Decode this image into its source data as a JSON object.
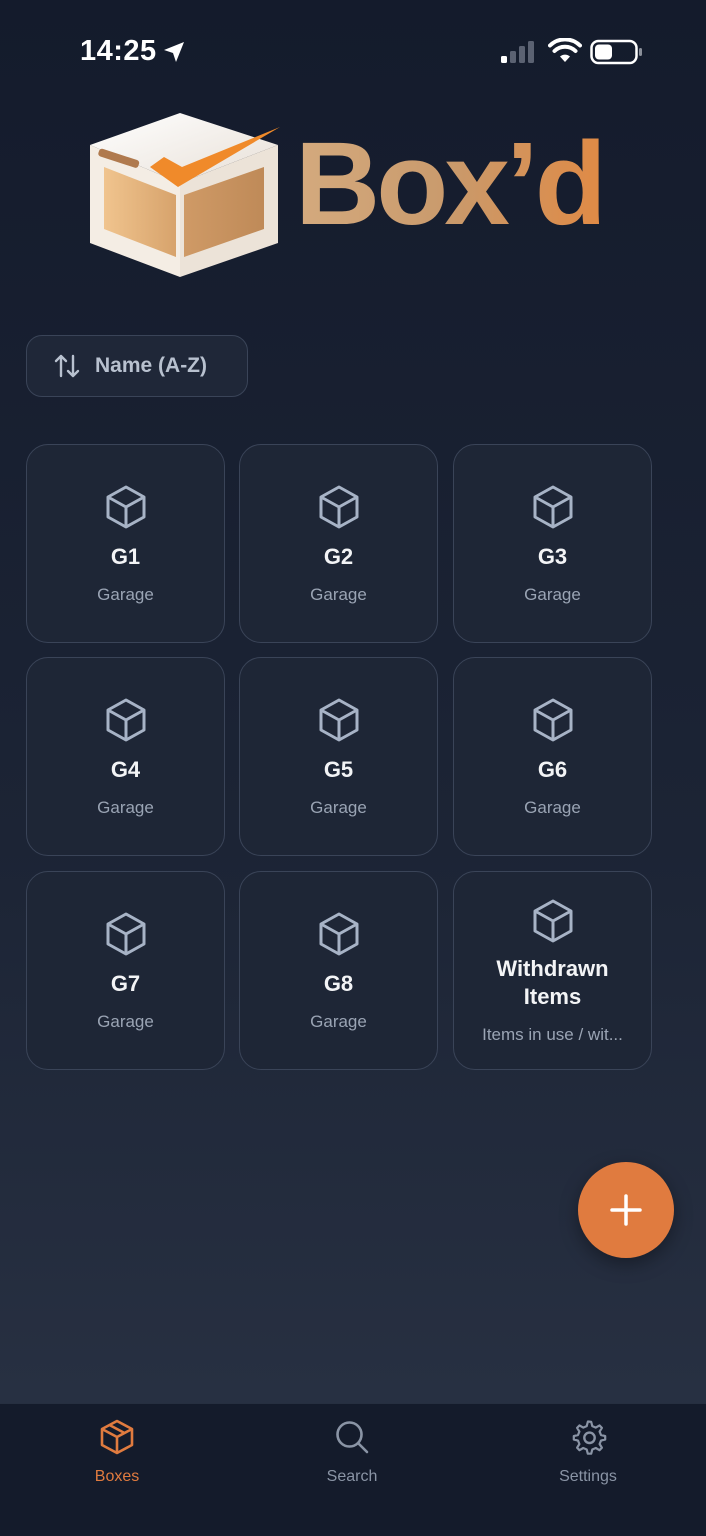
{
  "status_bar": {
    "time": "14:25"
  },
  "logo": {
    "text": "Box’d"
  },
  "sort": {
    "label": "Name (A-Z)"
  },
  "boxes": [
    {
      "name": "G1",
      "location": "Garage"
    },
    {
      "name": "G2",
      "location": "Garage"
    },
    {
      "name": "G3",
      "location": "Garage"
    },
    {
      "name": "G4",
      "location": "Garage"
    },
    {
      "name": "G5",
      "location": "Garage"
    },
    {
      "name": "G6",
      "location": "Garage"
    },
    {
      "name": "G7",
      "location": "Garage"
    },
    {
      "name": "G8",
      "location": "Garage"
    },
    {
      "name": "Withdrawn Items",
      "location": "Items in use / wit..."
    }
  ],
  "tabs": [
    {
      "label": "Boxes",
      "icon": "box-icon",
      "active": true
    },
    {
      "label": "Search",
      "icon": "search-icon",
      "active": false
    },
    {
      "label": "Settings",
      "icon": "gear-icon",
      "active": false
    }
  ],
  "colors": {
    "accent": "#e07b3f",
    "background": "#141b2c",
    "card": "#1e2636",
    "card_border": "#3a4458",
    "muted_text": "#9aa4b4"
  }
}
